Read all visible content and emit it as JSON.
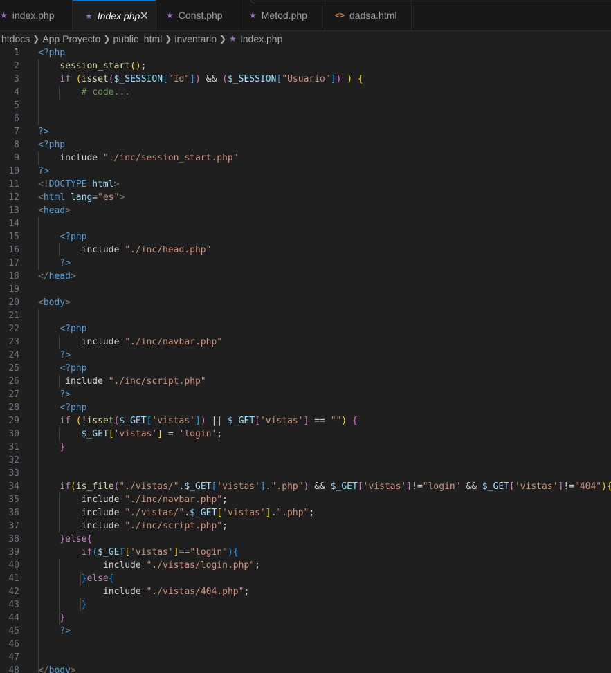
{
  "tabs": [
    {
      "label": "index.php",
      "icon": "php-elephant-icon",
      "active": false
    },
    {
      "label": "Index.php",
      "icon": "php-elephant-icon",
      "active": true
    },
    {
      "label": "Const.php",
      "icon": "php-elephant-icon",
      "active": false
    },
    {
      "label": "Metod.php",
      "icon": "php-elephant-icon",
      "active": false
    },
    {
      "label": "dadsa.html",
      "icon": "html-code-icon",
      "active": false
    }
  ],
  "breadcrumb": [
    "htdocs",
    "App Proyecto",
    "public_html",
    "inventario",
    "Index.php"
  ],
  "editor": {
    "current_line": 1,
    "lines": [
      [
        [
          "t-tag",
          "<?php"
        ]
      ],
      [
        [
          "t-fn",
          "    session_start"
        ],
        [
          "t-br1",
          "("
        ],
        [
          "t-br1",
          ")"
        ],
        [
          "t-op",
          ";"
        ]
      ],
      [
        [
          "t-ctl",
          "    if "
        ],
        [
          "t-br1",
          "("
        ],
        [
          "t-fn",
          "isset"
        ],
        [
          "t-br2",
          "("
        ],
        [
          "t-var",
          "$_SESSION"
        ],
        [
          "t-br3",
          "["
        ],
        [
          "t-str",
          "\"Id\""
        ],
        [
          "t-br3",
          "]"
        ],
        [
          "t-br2",
          ")"
        ],
        [
          "t-op",
          " && "
        ],
        [
          "t-br2",
          "("
        ],
        [
          "t-var",
          "$_SESSION"
        ],
        [
          "t-br3",
          "["
        ],
        [
          "t-str",
          "\"Usuario\""
        ],
        [
          "t-br3",
          "]"
        ],
        [
          "t-br2",
          ")"
        ],
        [
          "t-op",
          " "
        ],
        [
          "t-br1",
          ")"
        ],
        [
          "t-op",
          " "
        ],
        [
          "t-br1",
          "{"
        ]
      ],
      [
        [
          "t-cmt",
          "        # code..."
        ]
      ],
      [],
      [],
      [
        [
          "t-tag",
          "?>"
        ]
      ],
      [
        [
          "t-tag",
          "<?php"
        ]
      ],
      [
        [
          "t-inc",
          "    include "
        ],
        [
          "t-str",
          "\"./inc/session_start.php\""
        ]
      ],
      [
        [
          "t-tag",
          "?>"
        ]
      ],
      [
        [
          "t-ang",
          "<!"
        ],
        [
          "t-dt",
          "DOCTYPE"
        ],
        [
          "t-plain",
          " "
        ],
        [
          "t-attr",
          "html"
        ],
        [
          "t-ang",
          ">"
        ]
      ],
      [
        [
          "t-ang",
          "<"
        ],
        [
          "t-tag",
          "html"
        ],
        [
          "t-plain",
          " "
        ],
        [
          "t-attr",
          "lang"
        ],
        [
          "t-op",
          "="
        ],
        [
          "t-str",
          "\"es\""
        ],
        [
          "t-ang",
          ">"
        ]
      ],
      [
        [
          "t-ang",
          "<"
        ],
        [
          "t-tag",
          "head"
        ],
        [
          "t-ang",
          ">"
        ]
      ],
      [],
      [
        [
          "t-tag",
          "    <?php"
        ]
      ],
      [
        [
          "t-inc",
          "        include "
        ],
        [
          "t-str",
          "\"./inc/head.php\""
        ]
      ],
      [
        [
          "t-tag",
          "    ?>"
        ]
      ],
      [
        [
          "t-ang",
          "</"
        ],
        [
          "t-tag",
          "head"
        ],
        [
          "t-ang",
          ">"
        ]
      ],
      [],
      [
        [
          "t-ang",
          "<"
        ],
        [
          "t-tag",
          "body"
        ],
        [
          "t-ang",
          ">"
        ]
      ],
      [],
      [
        [
          "t-tag",
          "    <?php"
        ]
      ],
      [
        [
          "t-inc",
          "        include "
        ],
        [
          "t-str",
          "\"./inc/navbar.php\""
        ]
      ],
      [
        [
          "t-tag",
          "    ?>"
        ]
      ],
      [
        [
          "t-tag",
          "    <?php"
        ]
      ],
      [
        [
          "t-inc",
          "     include "
        ],
        [
          "t-str",
          "\"./inc/script.php\""
        ]
      ],
      [
        [
          "t-tag",
          "    ?>"
        ]
      ],
      [
        [
          "t-tag",
          "    <?php"
        ]
      ],
      [
        [
          "t-ctl",
          "    if "
        ],
        [
          "t-br1",
          "("
        ],
        [
          "t-op",
          "!"
        ],
        [
          "t-fn",
          "isset"
        ],
        [
          "t-br2",
          "("
        ],
        [
          "t-var",
          "$_GET"
        ],
        [
          "t-br3",
          "["
        ],
        [
          "t-str",
          "'vistas'"
        ],
        [
          "t-br3",
          "]"
        ],
        [
          "t-br2",
          ")"
        ],
        [
          "t-op",
          " || "
        ],
        [
          "t-var",
          "$_GET"
        ],
        [
          "t-br2",
          "["
        ],
        [
          "t-str",
          "'vistas'"
        ],
        [
          "t-br2",
          "]"
        ],
        [
          "t-op",
          " == "
        ],
        [
          "t-str",
          "\"\""
        ],
        [
          "t-br1",
          ")"
        ],
        [
          "t-op",
          " "
        ],
        [
          "t-br2",
          "{"
        ]
      ],
      [
        [
          "t-var",
          "        $_GET"
        ],
        [
          "t-br1",
          "["
        ],
        [
          "t-str",
          "'vistas'"
        ],
        [
          "t-br1",
          "]"
        ],
        [
          "t-op",
          " = "
        ],
        [
          "t-str",
          "'login'"
        ],
        [
          "t-op",
          ";"
        ]
      ],
      [
        [
          "t-br2",
          "    }"
        ]
      ],
      [],
      [],
      [
        [
          "t-ctl",
          "    if"
        ],
        [
          "t-br1",
          "("
        ],
        [
          "t-fn",
          "is_file"
        ],
        [
          "t-br2",
          "("
        ],
        [
          "t-str",
          "\"./vistas/\""
        ],
        [
          "t-op",
          "."
        ],
        [
          "t-var",
          "$_GET"
        ],
        [
          "t-br3",
          "["
        ],
        [
          "t-str",
          "'vistas'"
        ],
        [
          "t-br3",
          "]"
        ],
        [
          "t-op",
          "."
        ],
        [
          "t-str",
          "\".php\""
        ],
        [
          "t-br2",
          ")"
        ],
        [
          "t-op",
          " && "
        ],
        [
          "t-var",
          "$_GET"
        ],
        [
          "t-br2",
          "["
        ],
        [
          "t-str",
          "'vistas'"
        ],
        [
          "t-br2",
          "]"
        ],
        [
          "t-op",
          "!="
        ],
        [
          "t-str",
          "\"login\""
        ],
        [
          "t-op",
          " && "
        ],
        [
          "t-var",
          "$_GET"
        ],
        [
          "t-br2",
          "["
        ],
        [
          "t-str",
          "'vistas'"
        ],
        [
          "t-br2",
          "]"
        ],
        [
          "t-op",
          "!="
        ],
        [
          "t-str",
          "\"404\""
        ],
        [
          "t-br1",
          ")"
        ],
        [
          "t-br1",
          "{"
        ]
      ],
      [
        [
          "t-inc",
          "        include "
        ],
        [
          "t-str",
          "\"./inc/navbar.php\""
        ],
        [
          "t-op",
          ";"
        ]
      ],
      [
        [
          "t-inc",
          "        include "
        ],
        [
          "t-str",
          "\"./vistas/\""
        ],
        [
          "t-op",
          "."
        ],
        [
          "t-var",
          "$_GET"
        ],
        [
          "t-br1",
          "["
        ],
        [
          "t-str",
          "'vistas'"
        ],
        [
          "t-br1",
          "]"
        ],
        [
          "t-op",
          "."
        ],
        [
          "t-str",
          "\".php\""
        ],
        [
          "t-op",
          ";"
        ]
      ],
      [
        [
          "t-inc",
          "        include "
        ],
        [
          "t-str",
          "\"./inc/script.php\""
        ],
        [
          "t-op",
          ";"
        ]
      ],
      [
        [
          "t-br2",
          "    }"
        ],
        [
          "t-ctl",
          "else"
        ],
        [
          "t-br2",
          "{"
        ]
      ],
      [
        [
          "t-ctl",
          "        if"
        ],
        [
          "t-br3",
          "("
        ],
        [
          "t-var",
          "$_GET"
        ],
        [
          "t-br1",
          "["
        ],
        [
          "t-str",
          "'vistas'"
        ],
        [
          "t-br1",
          "]"
        ],
        [
          "t-op",
          "=="
        ],
        [
          "t-str",
          "\"login\""
        ],
        [
          "t-br3",
          ")"
        ],
        [
          "t-br3",
          "{"
        ]
      ],
      [
        [
          "t-inc",
          "            include "
        ],
        [
          "t-str",
          "\"./vistas/login.php\""
        ],
        [
          "t-op",
          ";"
        ]
      ],
      [
        [
          "t-br3",
          "        }"
        ],
        [
          "t-ctl",
          "else"
        ],
        [
          "t-br3",
          "{"
        ]
      ],
      [
        [
          "t-inc",
          "            include "
        ],
        [
          "t-str",
          "\"./vistas/404.php\""
        ],
        [
          "t-op",
          ";"
        ]
      ],
      [
        [
          "t-br3",
          "        }"
        ]
      ],
      [
        [
          "t-br2",
          "    }"
        ]
      ],
      [
        [
          "t-tag",
          "    ?>"
        ]
      ],
      [],
      [],
      [
        [
          "t-ang",
          "</"
        ],
        [
          "t-tag",
          "body"
        ],
        [
          "t-ang",
          ">"
        ]
      ]
    ]
  }
}
